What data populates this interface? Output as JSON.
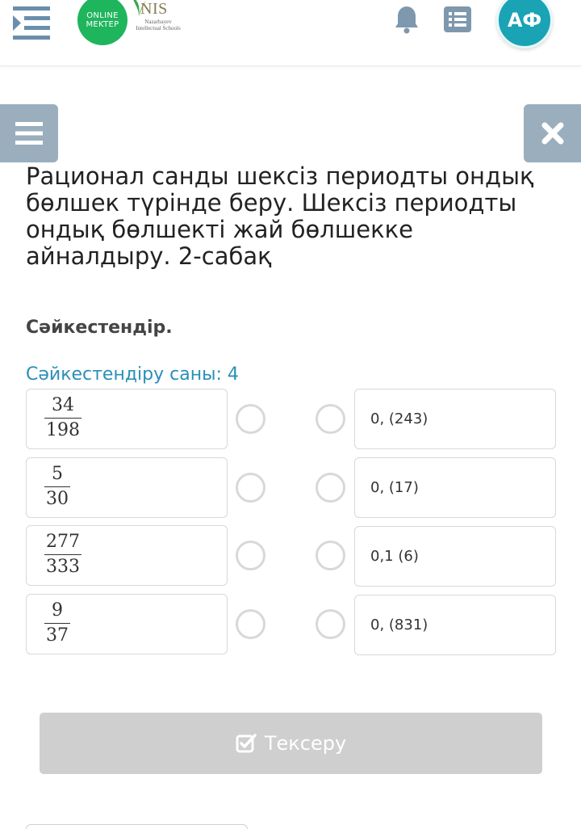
{
  "header": {
    "logo_online_line1": "ONLINE",
    "logo_online_line2": "MEKTEP",
    "logo_nis_main": "NIS",
    "logo_nis_sub": "Nazarbayev Intellectual Schools",
    "avatar_initials": "АФ",
    "icons": [
      "menu-icon",
      "bell-icon",
      "list-icon"
    ]
  },
  "lesson": {
    "title": "Рационал санды шексіз периодты ондық бөлшек түрінде беру. Шексіз периодты ондық бөлшекті жай бөлшекке айналдыру. 2-сабақ"
  },
  "task": {
    "heading": "Сәйкестендір.",
    "match_count": "Сәйкестендіру саны: 4",
    "left_items": [
      {
        "numerator": "34",
        "denominator": "198"
      },
      {
        "numerator": "5",
        "denominator": "30"
      },
      {
        "numerator": "277",
        "denominator": "333"
      },
      {
        "numerator": "9",
        "denominator": "37"
      }
    ],
    "right_items": [
      {
        "label": "0, (243)"
      },
      {
        "label": "0, (17)"
      },
      {
        "label": "0,1 (6)"
      },
      {
        "label": "0, (831)"
      }
    ]
  },
  "actions": {
    "check_label": "Тексеру"
  },
  "colors": {
    "accent_teal": "#1aa3b5",
    "side_button": "#9aaebd",
    "link_blue": "#2a8fb8",
    "disabled_button": "#cfcfcf",
    "logo_green": "#1fb55c"
  }
}
